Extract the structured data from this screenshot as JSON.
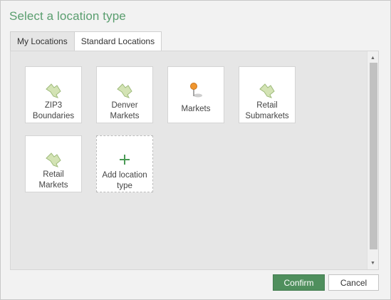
{
  "dialog": {
    "title": "Select a location type"
  },
  "tabs": [
    {
      "label": "My Locations",
      "active": true
    },
    {
      "label": "Standard Locations",
      "active": false
    }
  ],
  "tiles": [
    {
      "line1": "ZIP3",
      "line2": "Boundaries",
      "icon": "map-shape-icon"
    },
    {
      "line1": "Denver",
      "line2": "Markets",
      "icon": "map-shape-icon"
    },
    {
      "line1": "Markets",
      "line2": "",
      "icon": "map-pin-icon"
    },
    {
      "line1": "Retail",
      "line2": "Submarkets",
      "icon": "map-shape-icon"
    },
    {
      "line1": "Retail",
      "line2": "Markets",
      "icon": "map-shape-icon"
    }
  ],
  "add_tile": {
    "line1": "Add location",
    "line2": "type",
    "icon": "plus-icon"
  },
  "buttons": {
    "confirm": "Confirm",
    "cancel": "Cancel"
  },
  "colors": {
    "title": "#5a9e6f",
    "shape_fill": "#d3e3b4",
    "shape_stroke": "#9fbb7c",
    "pin_head": "#f0962e",
    "confirm_bg": "#4f8f5d",
    "plus": "#4a9a55"
  }
}
